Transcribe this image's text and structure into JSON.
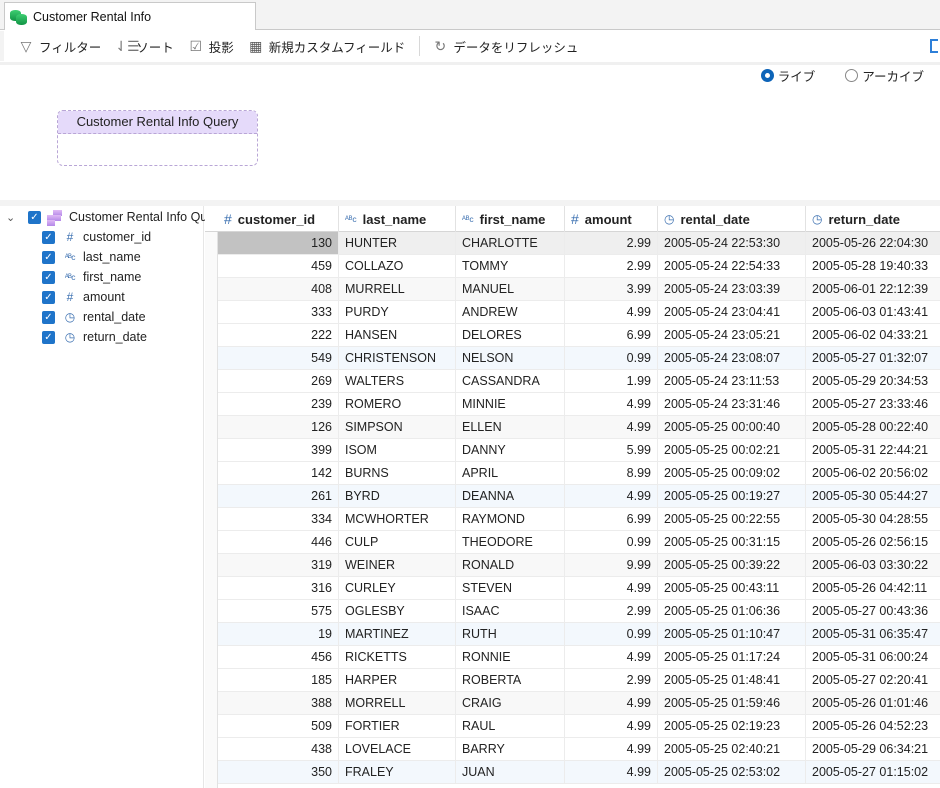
{
  "tab": {
    "title": "Customer Rental Info",
    "icon": "database-icon"
  },
  "toolbar": {
    "filter": "フィルター",
    "sort": "ソート",
    "projection": "投影",
    "new_custom_field": "新規カスタムフィールド",
    "refresh": "データをリフレッシュ"
  },
  "mode": {
    "live": "ライブ",
    "archive": "アーカイブ",
    "selected": "live"
  },
  "query_box": {
    "title": "Customer Rental Info Query"
  },
  "tree": {
    "root": "Customer Rental Info Query",
    "fields": [
      {
        "name": "customer_id",
        "type": "number",
        "checked": true
      },
      {
        "name": "last_name",
        "type": "string",
        "checked": true
      },
      {
        "name": "first_name",
        "type": "string",
        "checked": true
      },
      {
        "name": "amount",
        "type": "number",
        "checked": true
      },
      {
        "name": "rental_date",
        "type": "datetime",
        "checked": true
      },
      {
        "name": "return_date",
        "type": "datetime",
        "checked": true
      }
    ]
  },
  "grid": {
    "columns": [
      {
        "label": "customer_id",
        "type": "number",
        "icon": "#"
      },
      {
        "label": "last_name",
        "type": "string",
        "icon": "ᴬᴮc"
      },
      {
        "label": "first_name",
        "type": "string",
        "icon": "ᴬᴮc"
      },
      {
        "label": "amount",
        "type": "number",
        "icon": "#"
      },
      {
        "label": "rental_date",
        "type": "datetime",
        "icon": "◷"
      },
      {
        "label": "return_date",
        "type": "datetime",
        "icon": "◷"
      }
    ],
    "rows": [
      [
        "130",
        "HUNTER",
        "CHARLOTTE",
        "2.99",
        "2005-05-24 22:53:30",
        "2005-05-26 22:04:30"
      ],
      [
        "459",
        "COLLAZO",
        "TOMMY",
        "2.99",
        "2005-05-24 22:54:33",
        "2005-05-28 19:40:33"
      ],
      [
        "408",
        "MURRELL",
        "MANUEL",
        "3.99",
        "2005-05-24 23:03:39",
        "2005-06-01 22:12:39"
      ],
      [
        "333",
        "PURDY",
        "ANDREW",
        "4.99",
        "2005-05-24 23:04:41",
        "2005-06-03 01:43:41"
      ],
      [
        "222",
        "HANSEN",
        "DELORES",
        "6.99",
        "2005-05-24 23:05:21",
        "2005-06-02 04:33:21"
      ],
      [
        "549",
        "CHRISTENSON",
        "NELSON",
        "0.99",
        "2005-05-24 23:08:07",
        "2005-05-27 01:32:07"
      ],
      [
        "269",
        "WALTERS",
        "CASSANDRA",
        "1.99",
        "2005-05-24 23:11:53",
        "2005-05-29 20:34:53"
      ],
      [
        "239",
        "ROMERO",
        "MINNIE",
        "4.99",
        "2005-05-24 23:31:46",
        "2005-05-27 23:33:46"
      ],
      [
        "126",
        "SIMPSON",
        "ELLEN",
        "4.99",
        "2005-05-25 00:00:40",
        "2005-05-28 00:22:40"
      ],
      [
        "399",
        "ISOM",
        "DANNY",
        "5.99",
        "2005-05-25 00:02:21",
        "2005-05-31 22:44:21"
      ],
      [
        "142",
        "BURNS",
        "APRIL",
        "8.99",
        "2005-05-25 00:09:02",
        "2005-06-02 20:56:02"
      ],
      [
        "261",
        "BYRD",
        "DEANNA",
        "4.99",
        "2005-05-25 00:19:27",
        "2005-05-30 05:44:27"
      ],
      [
        "334",
        "MCWHORTER",
        "RAYMOND",
        "6.99",
        "2005-05-25 00:22:55",
        "2005-05-30 04:28:55"
      ],
      [
        "446",
        "CULP",
        "THEODORE",
        "0.99",
        "2005-05-25 00:31:15",
        "2005-05-26 02:56:15"
      ],
      [
        "319",
        "WEINER",
        "RONALD",
        "9.99",
        "2005-05-25 00:39:22",
        "2005-06-03 03:30:22"
      ],
      [
        "316",
        "CURLEY",
        "STEVEN",
        "4.99",
        "2005-05-25 00:43:11",
        "2005-05-26 04:42:11"
      ],
      [
        "575",
        "OGLESBY",
        "ISAAC",
        "2.99",
        "2005-05-25 01:06:36",
        "2005-05-27 00:43:36"
      ],
      [
        "19",
        "MARTINEZ",
        "RUTH",
        "0.99",
        "2005-05-25 01:10:47",
        "2005-05-31 06:35:47"
      ],
      [
        "456",
        "RICKETTS",
        "RONNIE",
        "4.99",
        "2005-05-25 01:17:24",
        "2005-05-31 06:00:24"
      ],
      [
        "185",
        "HARPER",
        "ROBERTA",
        "2.99",
        "2005-05-25 01:48:41",
        "2005-05-27 02:20:41"
      ],
      [
        "388",
        "MORRELL",
        "CRAIG",
        "4.99",
        "2005-05-25 01:59:46",
        "2005-05-26 01:01:46"
      ],
      [
        "509",
        "FORTIER",
        "RAUL",
        "4.99",
        "2005-05-25 02:19:23",
        "2005-05-26 04:52:23"
      ],
      [
        "438",
        "LOVELACE",
        "BARRY",
        "4.99",
        "2005-05-25 02:40:21",
        "2005-05-29 06:34:21"
      ],
      [
        "350",
        "FRALEY",
        "JUAN",
        "4.99",
        "2005-05-25 02:53:02",
        "2005-05-27 01:15:02"
      ]
    ],
    "selected_row": 0
  }
}
